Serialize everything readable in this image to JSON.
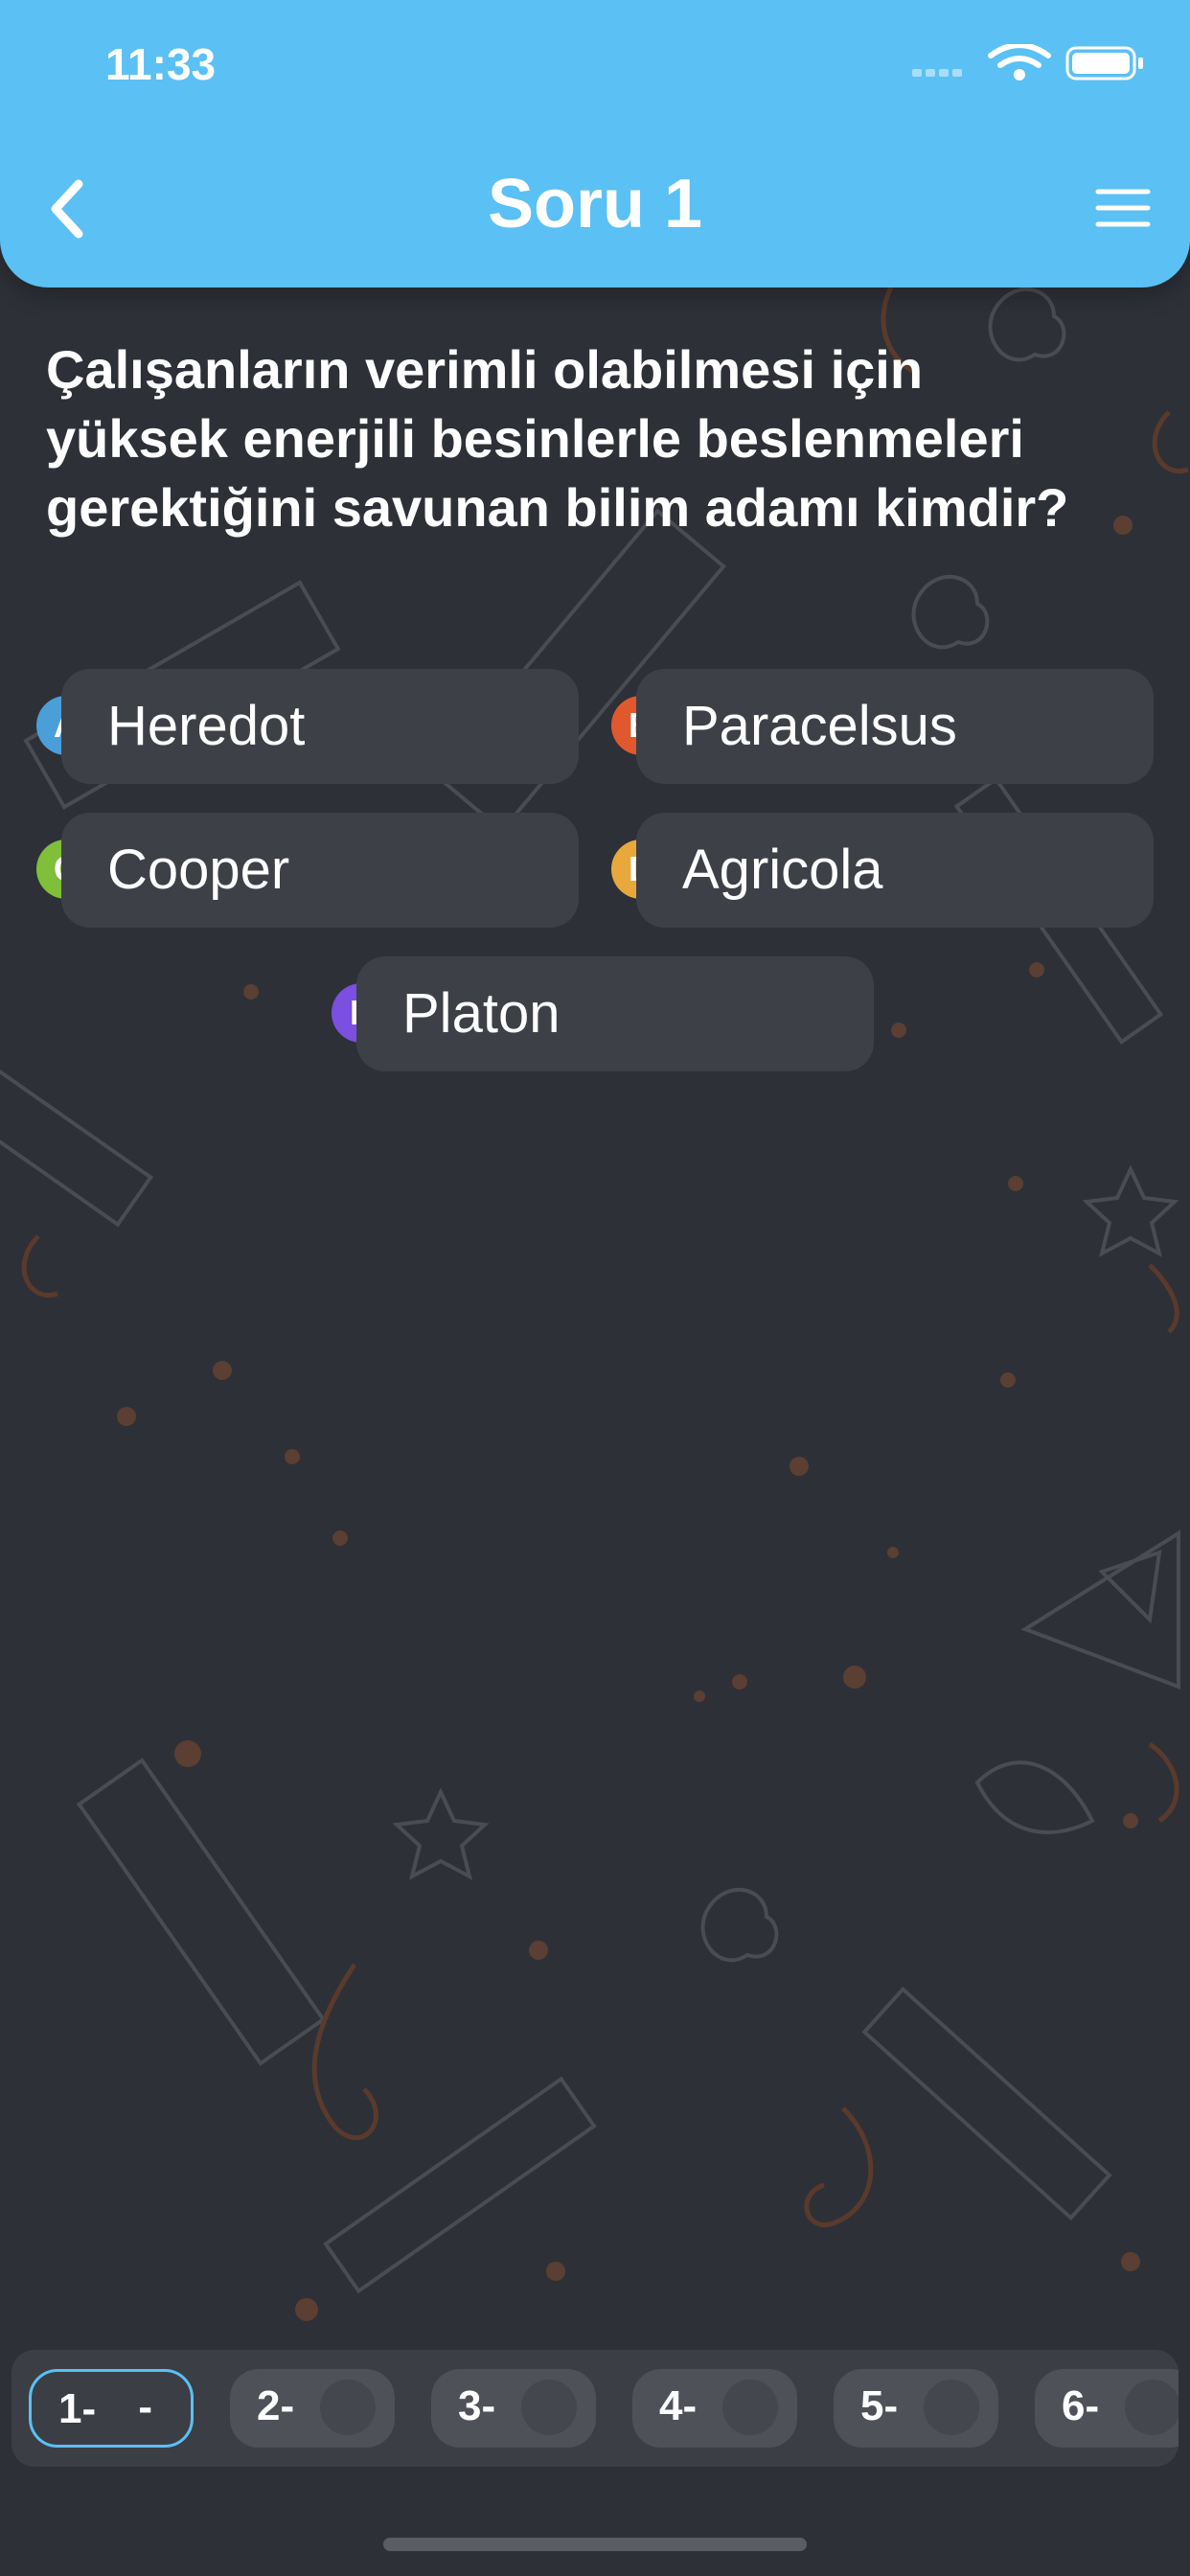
{
  "status_bar": {
    "time": "11:33"
  },
  "header": {
    "title": "Soru 1"
  },
  "question": {
    "text": "Çalışanların verimli olabilmesi için yüksek enerjili besinlerle beslenmeleri gerektiğini savunan bilim adamı kimdir?"
  },
  "options": [
    {
      "letter": "A",
      "label": "Heredot",
      "color": "#4a9fd8"
    },
    {
      "letter": "B",
      "label": "Paracelsus",
      "color": "#e0582e"
    },
    {
      "letter": "C",
      "label": "Cooper",
      "color": "#7fbf3a"
    },
    {
      "letter": "D",
      "label": "Agricola",
      "color": "#e8a83c"
    },
    {
      "letter": "E",
      "label": "Platon",
      "color": "#7b4fe0"
    }
  ],
  "question_nav": [
    {
      "label": "1-",
      "answer": "-"
    },
    {
      "label": "2-",
      "answer": ""
    },
    {
      "label": "3-",
      "answer": ""
    },
    {
      "label": "4-",
      "answer": ""
    },
    {
      "label": "5-",
      "answer": ""
    },
    {
      "label": "6-",
      "answer": ""
    }
  ],
  "colors": {
    "accent": "#5bc0f4",
    "background": "#2d3037",
    "option_bg": "#3e4047"
  }
}
